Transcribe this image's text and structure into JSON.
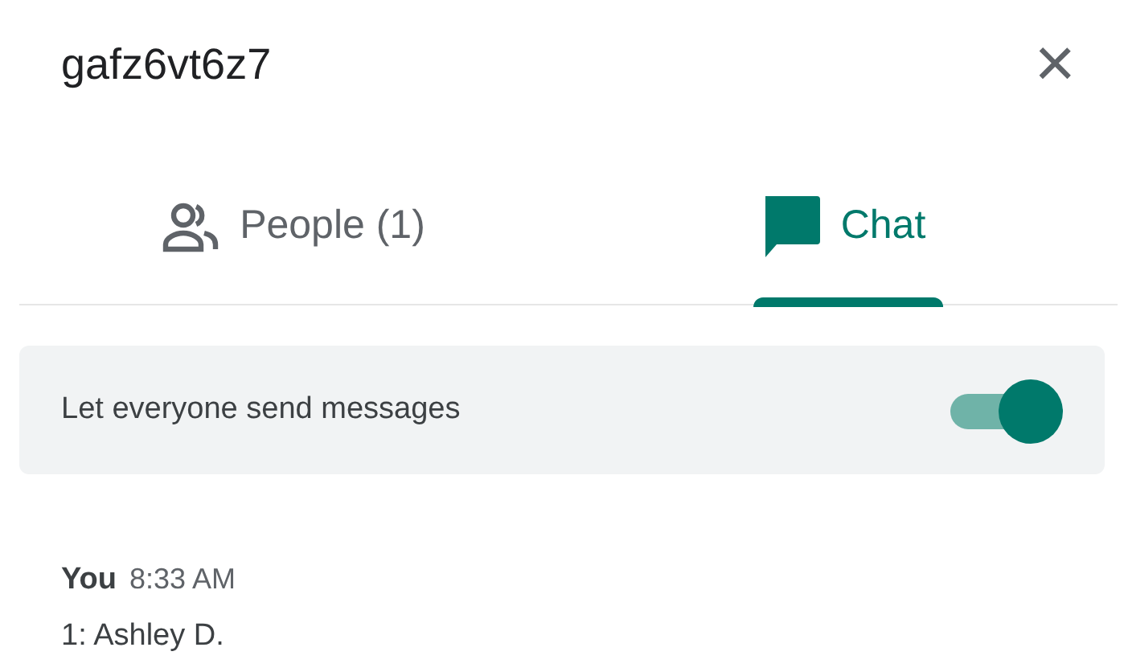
{
  "header": {
    "title": "gafz6vt6z7",
    "close": "×"
  },
  "tabs": [
    {
      "kind": "people",
      "label": "People (1)",
      "selected": false
    },
    {
      "kind": "chat",
      "label": "Chat",
      "selected": true
    }
  ],
  "setting": {
    "label": "Let everyone send messages",
    "on": true
  },
  "messages": [
    {
      "sender": "You",
      "time": "8:33 AM",
      "text": "1: Ashley D."
    }
  ]
}
